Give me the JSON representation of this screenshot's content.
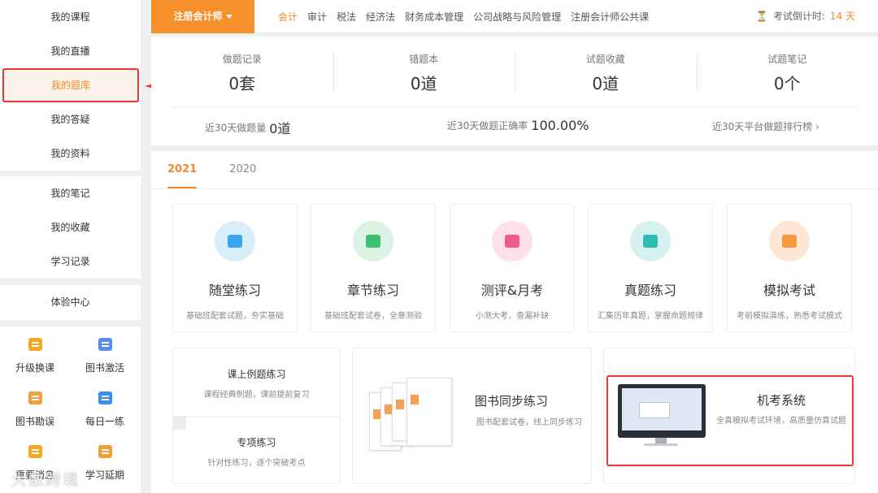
{
  "sidebar": {
    "group1": [
      "我的课程",
      "我的直播",
      "我的题库",
      "我的答疑",
      "我的资料"
    ],
    "group2": [
      "我的笔记",
      "我的收藏",
      "学习记录"
    ],
    "group3": [
      "体验中心"
    ],
    "tools": [
      {
        "label": "升级换课",
        "icon": "upgrade-icon"
      },
      {
        "label": "图书激活",
        "icon": "card-icon"
      },
      {
        "label": "图书勘误",
        "icon": "book-icon"
      },
      {
        "label": "每日一练",
        "icon": "edit-icon"
      },
      {
        "label": "重要消息",
        "icon": "bell-icon"
      },
      {
        "label": "学习延期",
        "icon": "calendar-icon"
      }
    ],
    "active": "我的题库"
  },
  "watermark": "大数跨境",
  "topbar": {
    "exam_select": "注册会计师",
    "subjects": [
      "会计",
      "审计",
      "税法",
      "经济法",
      "财务成本管理",
      "公司战略与风险管理",
      "注册会计师公共课"
    ],
    "active_subject": "会计",
    "countdown_label": "考试倒计时:",
    "countdown_value": "14 天"
  },
  "stats": {
    "items": [
      {
        "label": "做题记录",
        "value": "0套"
      },
      {
        "label": "错题本",
        "value": "0道"
      },
      {
        "label": "试题收藏",
        "value": "0道"
      },
      {
        "label": "试题笔记",
        "value": "0个"
      }
    ],
    "recent_count_label": "近30天做题量",
    "recent_count_value": "0道",
    "recent_rate_label": "近30天做题正确率",
    "recent_rate_value": "100.00%",
    "ranking_link": "近30天平台做题排行榜"
  },
  "year_tabs": [
    "2021",
    "2020"
  ],
  "active_year": "2021",
  "cards": [
    {
      "title": "随堂练习",
      "desc": "基础班配套试题，夯实基础",
      "icon": "video-icon"
    },
    {
      "title": "章节练习",
      "desc": "基础班配套试卷，全章测验",
      "icon": "star-icon"
    },
    {
      "title": "测评&月考",
      "desc": "小测大考，查漏补缺",
      "icon": "calendar-check-icon"
    },
    {
      "title": "真题练习",
      "desc": "汇集历年真题，掌握命题规律",
      "icon": "document-icon"
    },
    {
      "title": "模拟考试",
      "desc": "考前模拟演练，熟悉考试模式",
      "icon": "exam-icon"
    }
  ],
  "bottom": {
    "example_title": "课上例题练习",
    "example_desc": "课程经典例题，课前提前复习",
    "special_title": "专项练习",
    "special_desc": "针对性练习，逐个突破考点",
    "book_title": "图书同步练习",
    "book_desc": "图书配套试卷，线上同步练习",
    "computer_title": "机考系统",
    "computer_desc": "全真模拟考试环境，高质量仿真试题"
  },
  "colors": {
    "accent": "#f2892a",
    "highlight": "#ee3333"
  }
}
